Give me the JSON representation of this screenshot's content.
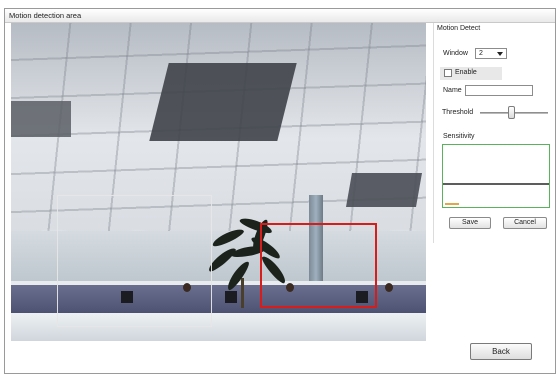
{
  "window": {
    "title": "Motion detection area"
  },
  "camera": {
    "description_regions": 2
  },
  "panel": {
    "title": "Motion Detect",
    "window_label": "Window",
    "window_value": "2",
    "enable_label": "Enable",
    "enable_checked": false,
    "name_label": "Name",
    "name_value": "",
    "threshold_label": "Threshold",
    "threshold_level": 0.45,
    "sensitivity_label": "Sensitivity",
    "save_label": "Save",
    "cancel_label": "Cancel"
  },
  "footer": {
    "back_label": "Back"
  },
  "colors": {
    "active_region": "#d71c1c",
    "inactive_region": "#e6e6e6",
    "sensitivity_border": "#5ab35a"
  }
}
